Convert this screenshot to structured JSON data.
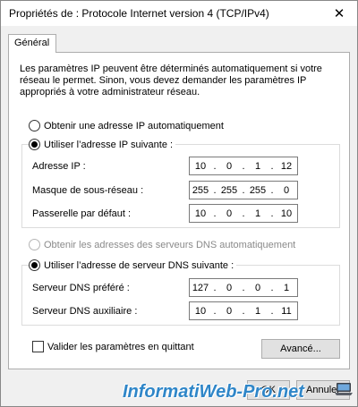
{
  "window": {
    "title": "Propriétés de : Protocole Internet version 4 (TCP/IPv4)",
    "close_glyph": "✕"
  },
  "tab": {
    "label": "Général"
  },
  "intro_text": "Les paramètres IP peuvent être déterminés automatiquement si votre réseau le permet. Sinon, vous devez demander les paramètres IP appropriés à votre administrateur réseau.",
  "ip_section": {
    "auto_label": "Obtenir une adresse IP automatiquement",
    "manual_label": "Utiliser l’adresse IP suivante :",
    "fields": [
      {
        "label": "Adresse IP :",
        "octets": [
          "10",
          "0",
          "1",
          "12"
        ]
      },
      {
        "label": "Masque de sous-réseau :",
        "octets": [
          "255",
          "255",
          "255",
          "0"
        ]
      },
      {
        "label": "Passerelle par défaut :",
        "octets": [
          "10",
          "0",
          "1",
          "10"
        ]
      }
    ],
    "selected": "manual"
  },
  "dns_section": {
    "auto_label": "Obtenir les adresses des serveurs DNS automatiquement",
    "manual_label": "Utiliser l’adresse de serveur DNS suivante :",
    "fields": [
      {
        "label": "Serveur DNS préféré :",
        "octets": [
          "127",
          "0",
          "0",
          "1"
        ]
      },
      {
        "label": "Serveur DNS auxiliaire :",
        "octets": [
          "10",
          "0",
          "1",
          "11"
        ]
      }
    ],
    "selected": "manual"
  },
  "validate_label": "Valider les paramètres en quittant",
  "advanced_label": "Avancé...",
  "ok_label": "OK",
  "cancel_label": "Annuler",
  "watermark": "InformatiWeb-Pro.net",
  "icons": {
    "laptop": "laptop-icon"
  }
}
